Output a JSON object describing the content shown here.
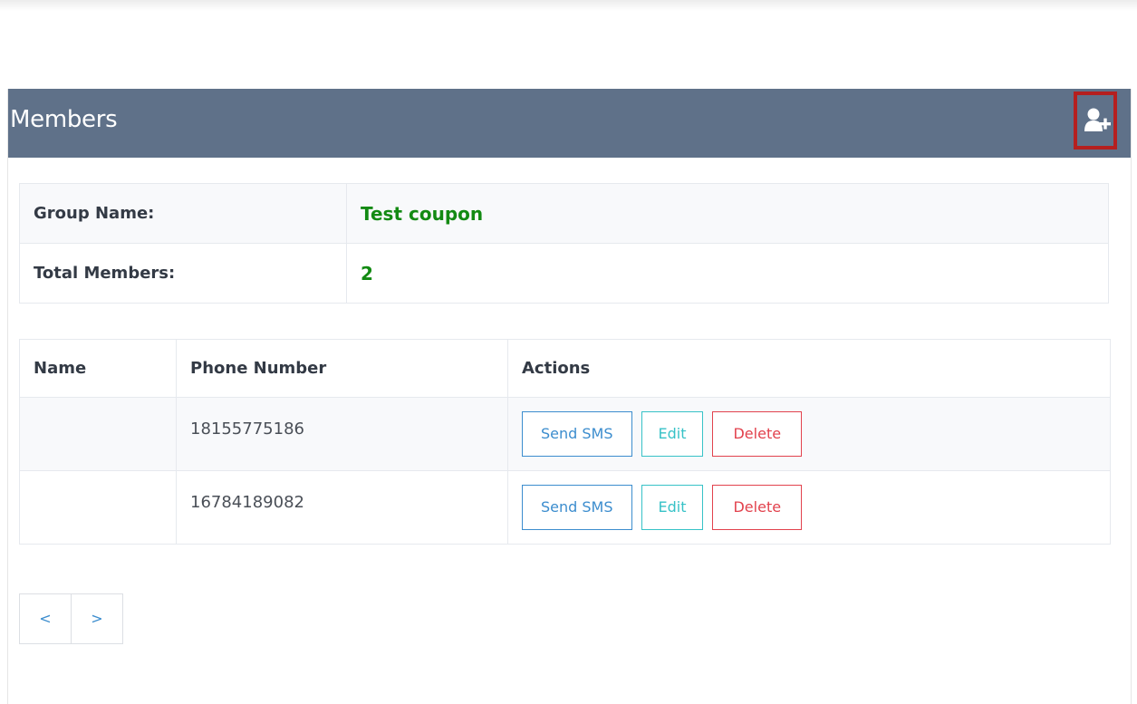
{
  "panel": {
    "title": "Members",
    "add_member_icon": "add-user-icon",
    "accent_header": "#5f7189",
    "highlight_border": "#b51f1f"
  },
  "group_info": {
    "group_name_label": "Group Name:",
    "group_name_value": "Test coupon",
    "total_members_label": "Total Members:",
    "total_members_value": "2",
    "value_color": "#138a13"
  },
  "members_table": {
    "headers": [
      "Name",
      "Phone Number",
      "Actions"
    ],
    "rows": [
      {
        "name": "",
        "phone": "18155775186"
      },
      {
        "name": "",
        "phone": "16784189082"
      }
    ],
    "actions": {
      "send_sms": "Send SMS",
      "edit": "Edit",
      "delete": "Delete"
    }
  },
  "pagination": {
    "prev": "<",
    "next": ">"
  }
}
